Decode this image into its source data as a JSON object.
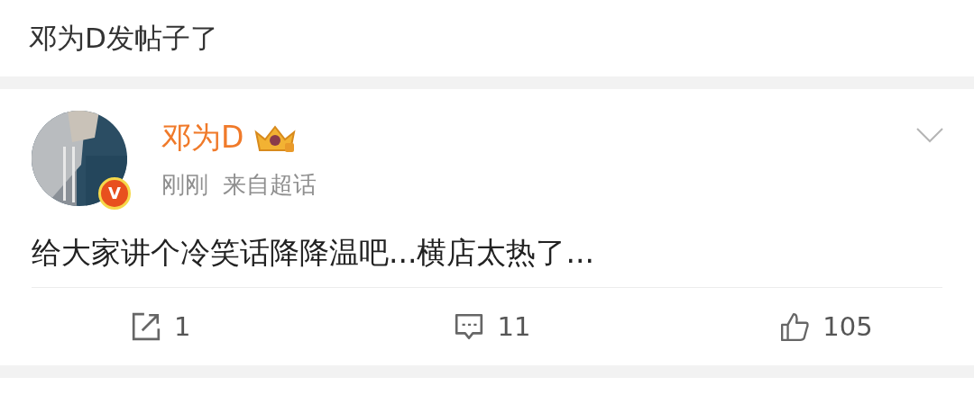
{
  "header": {
    "title": "邓为D发帖子了"
  },
  "post": {
    "author": "邓为D",
    "verified_badge": "V",
    "time": "刚刚",
    "source": "来自超话",
    "text": "给大家讲个冷笑话降降温吧...横店太热了...",
    "actions": [
      {
        "kind": "repost",
        "count": "1"
      },
      {
        "kind": "comment",
        "count": "11"
      },
      {
        "kind": "like",
        "count": "105"
      }
    ]
  }
}
